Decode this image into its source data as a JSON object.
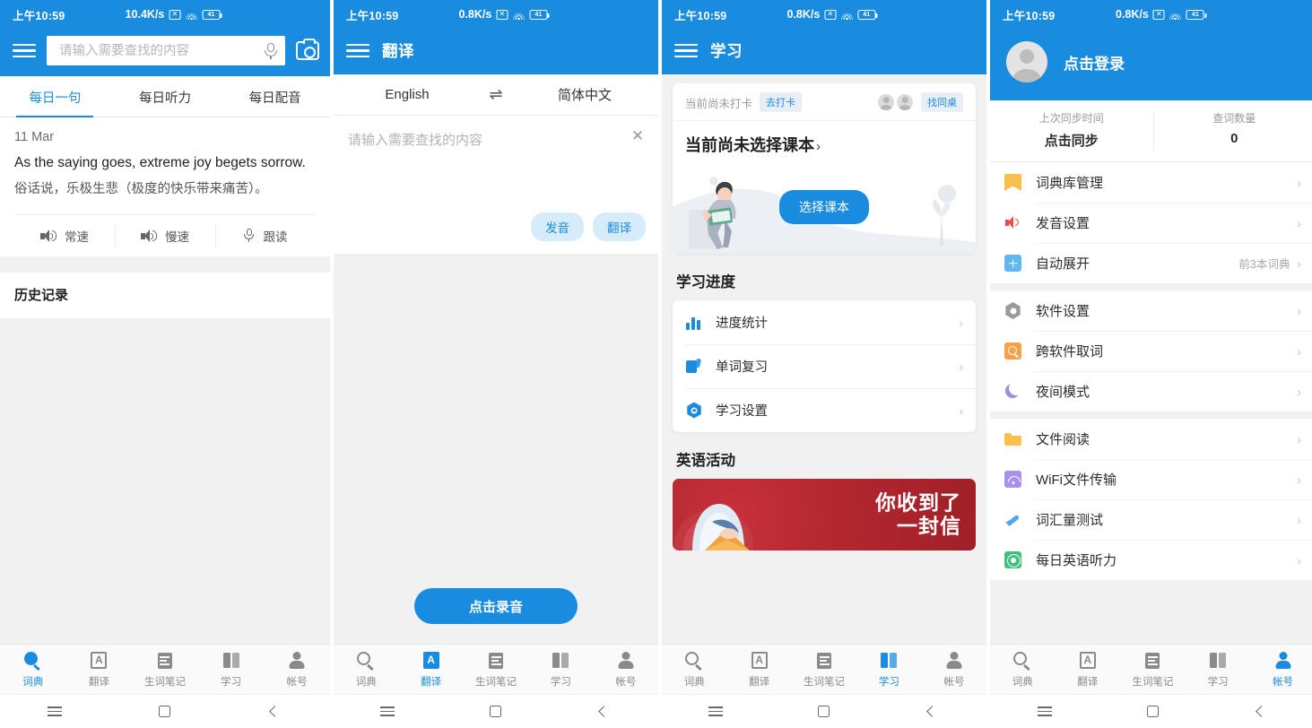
{
  "status_bar": {
    "time": "上午10:59",
    "speeds": [
      "10.4K/s",
      "0.8K/s",
      "0.8K/s",
      "0.8K/s"
    ],
    "battery": "41",
    "x_icon": "✕"
  },
  "colors": {
    "brand_blue": "#1a8ce0",
    "pill_bg": "#d6ecfb",
    "banner_red": "#b32730"
  },
  "bottom_nav": {
    "items": [
      {
        "label": "词典",
        "icon": "magnifier-icon"
      },
      {
        "label": "翻译",
        "icon": "translate-a-icon"
      },
      {
        "label": "生词笔记",
        "icon": "notes-icon"
      },
      {
        "label": "学习",
        "icon": "book-icon"
      },
      {
        "label": "帐号",
        "icon": "person-icon"
      }
    ]
  },
  "sys_nav": {
    "menu": "menu-icon",
    "home": "home-square-icon",
    "back": "back-chevron-icon"
  },
  "panel1": {
    "search": {
      "placeholder": "请输入需要查找的内容",
      "value": ""
    },
    "icons": {
      "menu": "hamburger-icon",
      "mic": "microphone-icon",
      "camera": "camera-icon"
    },
    "tabs": [
      {
        "label": "每日一句",
        "active": true
      },
      {
        "label": "每日听力",
        "active": false
      },
      {
        "label": "每日配音",
        "active": false
      }
    ],
    "daily": {
      "date": "11 Mar",
      "english": "As the saying goes, extreme joy begets sorrow.",
      "chinese": "俗话说，乐极生悲（极度的快乐带来痛苦）。",
      "controls": [
        {
          "label": "常速",
          "icon": "speaker-icon"
        },
        {
          "label": "慢速",
          "icon": "speaker-icon"
        },
        {
          "label": "跟读",
          "icon": "microphone-icon"
        }
      ]
    },
    "history_title": "历史记录"
  },
  "panel2": {
    "title": "翻译",
    "source_lang": "English",
    "target_lang": "简体中文",
    "swap_icon": "swap-arrows-icon",
    "input": {
      "placeholder": "请输入需要查找的内容",
      "value": ""
    },
    "clear_icon": "close-x-icon",
    "buttons": {
      "pronounce": "发音",
      "translate": "翻译"
    },
    "record_button": "点击录音"
  },
  "panel3": {
    "title": "学习",
    "checkin": {
      "status": "当前尚未打卡",
      "action": "去打卡",
      "find_partner": "找同桌"
    },
    "book": {
      "title": "当前尚未选择课本",
      "chevron": "›",
      "select_button": "选择课本"
    },
    "progress": {
      "section_title": "学习进度",
      "items": [
        {
          "label": "进度统计",
          "icon": "bar-chart-icon"
        },
        {
          "label": "单词复习",
          "icon": "flashcards-icon"
        },
        {
          "label": "学习设置",
          "icon": "hex-gear-icon"
        }
      ]
    },
    "activity": {
      "section_title": "英语活动",
      "banner_line1": "你收到了",
      "banner_line2": "一封信"
    }
  },
  "panel4": {
    "login_text": "点击登录",
    "avatar_icon": "avatar-icon",
    "stats": [
      {
        "label": "上次同步时间",
        "value": "点击同步"
      },
      {
        "label": "查词数量",
        "value": "0"
      }
    ],
    "groups": [
      {
        "items": [
          {
            "label": "词典库管理",
            "icon": "bookmark-icon",
            "value": ""
          },
          {
            "label": "发音设置",
            "icon": "speaker-red-icon",
            "value": ""
          },
          {
            "label": "自动展开",
            "icon": "plus-blue-icon",
            "value": "前3本词典"
          }
        ]
      },
      {
        "items": [
          {
            "label": "软件设置",
            "icon": "gear-gray-icon",
            "value": ""
          },
          {
            "label": "跨软件取词",
            "icon": "search-orange-icon",
            "value": ""
          },
          {
            "label": "夜间模式",
            "icon": "moon-icon",
            "value": ""
          }
        ]
      },
      {
        "items": [
          {
            "label": "文件阅读",
            "icon": "folder-icon",
            "value": ""
          },
          {
            "label": "WiFi文件传输",
            "icon": "wifi-purple-icon",
            "value": ""
          },
          {
            "label": "词汇量测试",
            "icon": "pen-icon",
            "value": ""
          },
          {
            "label": "每日英语听力",
            "icon": "listen-green-icon",
            "value": ""
          }
        ]
      }
    ]
  }
}
